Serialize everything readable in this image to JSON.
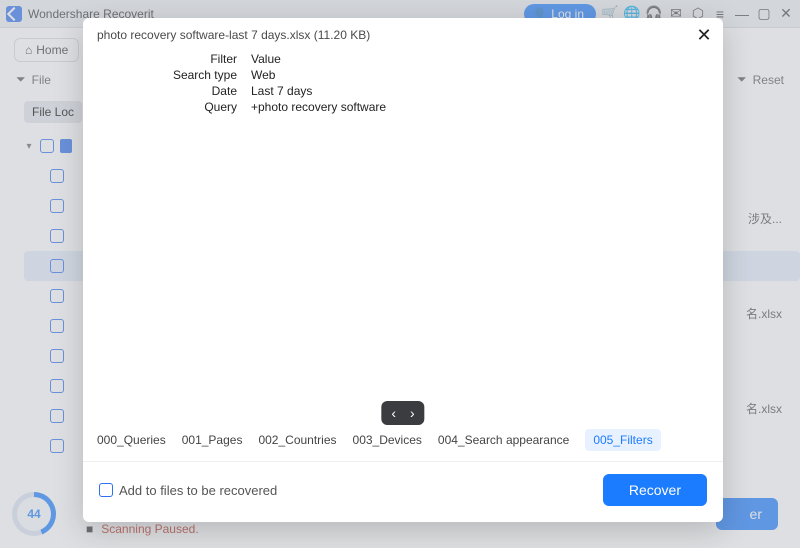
{
  "titlebar": {
    "app_name": "Wondershare Recoverit"
  },
  "login": "Log in",
  "home": "Home",
  "filterbar": {
    "type_label": "File",
    "reset_label": "Reset"
  },
  "tree": {
    "group_label": "File Loc"
  },
  "right_labels": {
    "r1": "涉及...",
    "r2": "名.xlsx",
    "r3": "名.xlsx"
  },
  "preview": {
    "filename": "photo recovery software-last 7 days.xlsx (11.20 KB)",
    "heads": {
      "filter": "Filter",
      "value": "Value"
    },
    "rows": [
      {
        "k": "Search type",
        "v": "Web"
      },
      {
        "k": "Date",
        "v": "Last 7 days"
      },
      {
        "k": "Query",
        "v": "+photo recovery software"
      }
    ],
    "tabs": [
      "000_Queries",
      "001_Pages",
      "002_Countries",
      "003_Devices",
      "004_Search appearance",
      "005_Filters"
    ],
    "active_tab": "005_Filters",
    "add_label": "Add to files to be recovered",
    "recover_label": "Recover"
  },
  "progress": {
    "pct": "44"
  },
  "status": {
    "text": "Scanning Paused."
  },
  "bg_recover_suffix": "er",
  "chart_data": {
    "type": "table",
    "title": "photo recovery software-last 7 days.xlsx",
    "columns": [
      "Filter",
      "Value"
    ],
    "rows": [
      [
        "Search type",
        "Web"
      ],
      [
        "Date",
        "Last 7 days"
      ],
      [
        "Query",
        "+photo recovery software"
      ]
    ]
  }
}
